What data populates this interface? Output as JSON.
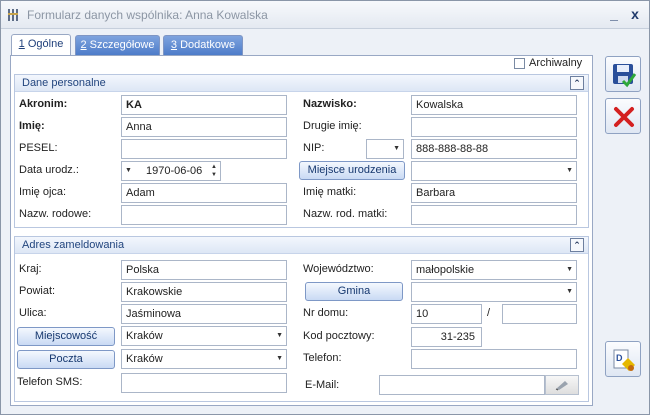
{
  "window": {
    "title": "Formularz danych wspólnika: Anna Kowalska",
    "minimize": "_",
    "close": "x"
  },
  "tabs": [
    {
      "label": "1 Ogólne"
    },
    {
      "label": "2 Szczegółowe"
    },
    {
      "label": "3 Dodatkowe"
    }
  ],
  "archiwalny": {
    "label": "Archiwalny",
    "checked": false
  },
  "personal": {
    "title": "Dane personalne",
    "akronim": {
      "label": "Akronim:",
      "value": "KA"
    },
    "nazwisko": {
      "label": "Nazwisko:",
      "value": "Kowalska"
    },
    "imie": {
      "label": "Imię:",
      "value": "Anna"
    },
    "drugie_imie": {
      "label": "Drugie imię:",
      "value": ""
    },
    "pesel": {
      "label": "PESEL:",
      "value": ""
    },
    "nip": {
      "label": "NIP:",
      "prefix": "",
      "value": "888-888-88-88"
    },
    "data_urodz": {
      "label": "Data urodz.:",
      "value": "1970-06-06"
    },
    "miejsce_urodzenia": {
      "label": "Miejsce urodzenia",
      "value": ""
    },
    "imie_ojca": {
      "label": "Imię ojca:",
      "value": "Adam"
    },
    "imie_matki": {
      "label": "Imię matki:",
      "value": "Barbara"
    },
    "nazw_rodowe": {
      "label": "Nazw. rodowe:",
      "value": ""
    },
    "nazw_rod_matki": {
      "label": "Nazw. rod. matki:",
      "value": ""
    }
  },
  "address": {
    "title": "Adres zameldowania",
    "kraj": {
      "label": "Kraj:",
      "value": "Polska"
    },
    "wojewodztwo": {
      "label": "Województwo:",
      "value": "małopolskie"
    },
    "powiat": {
      "label": "Powiat:",
      "value": "Krakowskie"
    },
    "gmina": {
      "label": "Gmina",
      "value": ""
    },
    "ulica": {
      "label": "Ulica:",
      "value": "Jaśminowa"
    },
    "nr_domu": {
      "label": "Nr domu:",
      "value": "10",
      "sep": "/",
      "lokal": ""
    },
    "miejscowosc": {
      "label": "Miejscowość",
      "value": "Kraków"
    },
    "kod_pocztowy": {
      "label": "Kod pocztowy:",
      "value": "31-235"
    },
    "poczta": {
      "label": "Poczta",
      "value": "Kraków"
    },
    "telefon": {
      "label": "Telefon:",
      "value": ""
    },
    "telefon_sms": {
      "label": "Telefon SMS:",
      "value": ""
    },
    "email": {
      "label": "E-Mail:",
      "value": ""
    }
  }
}
